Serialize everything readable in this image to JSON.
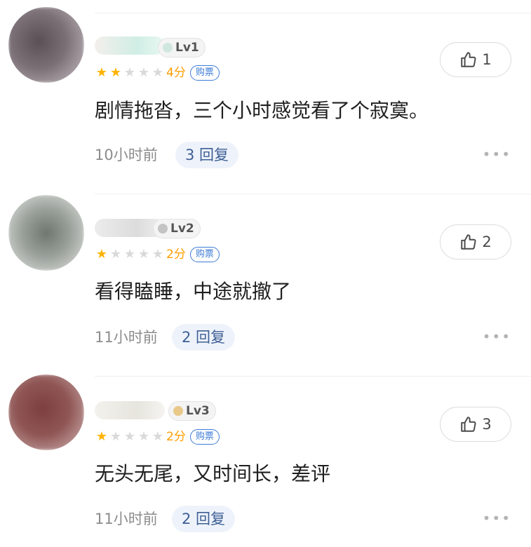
{
  "comments": [
    {
      "level": "Lv1",
      "score_text": "4分",
      "ticket_label": "购票",
      "stars_on": 2,
      "text": "剧情拖沓，三个小时感觉看了个寂寞。",
      "time": "10小时前",
      "reply_label": "3 回复",
      "like_count": "1",
      "more_label": "•••",
      "avatar_color": "#6e6266",
      "name_tint": "#c9ece0"
    },
    {
      "level": "Lv2",
      "score_text": "2分",
      "ticket_label": "购票",
      "stars_on": 1,
      "text": "看得瞌睡，中途就撤了",
      "time": "11小时前",
      "reply_label": "2 回复",
      "like_count": "2",
      "more_label": "•••",
      "avatar_color": "#8e948e",
      "name_tint": "#e4e4e4"
    },
    {
      "level": "Lv3",
      "score_text": "2分",
      "ticket_label": "购票",
      "stars_on": 1,
      "text": "无头无尾，又时间长，差评",
      "time": "11小时前",
      "reply_label": "2 回复",
      "like_count": "3",
      "more_label": "•••",
      "avatar_color": "#8a4d4c",
      "name_tint": "#ecebe4"
    }
  ],
  "colors": {
    "star_on": "#ffb400",
    "star_off": "#d9d9d9",
    "score": "#ff9e00",
    "ticket": "#3d7bd6",
    "reply_bg": "#eef3fb"
  },
  "icons": {
    "like": "thumbs-up-icon",
    "more": "more-dots-icon",
    "star": "star-icon"
  }
}
